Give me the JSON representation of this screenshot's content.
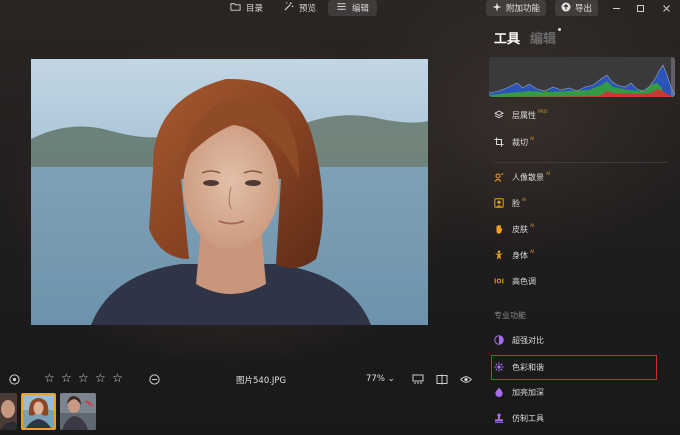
{
  "top_bar": {
    "tabs": [
      {
        "label": "目录",
        "icon": "folder-icon"
      },
      {
        "label": "预览",
        "icon": "magic-wand-icon"
      },
      {
        "label": "编辑",
        "icon": "sliders-icon"
      }
    ],
    "addon_label": "附加功能",
    "export_label": "导出"
  },
  "panel": {
    "tabs": [
      "工具",
      "编辑"
    ],
    "items": [
      {
        "label": "层属性",
        "sup": "PRO",
        "icon": "layers-icon"
      },
      {
        "label": "裁切",
        "sup": "AI",
        "icon": "crop-icon"
      },
      {
        "label": "人像散景",
        "sup": "AI",
        "icon": "portrait-bokeh-icon"
      },
      {
        "label": "脸",
        "sup": "AI",
        "icon": "face-icon"
      },
      {
        "label": "皮肤",
        "sup": "AI",
        "icon": "skin-icon"
      },
      {
        "label": "身体",
        "sup": "AI",
        "icon": "body-icon"
      },
      {
        "label": "高色调",
        "sup": "",
        "icon": "tone-icon"
      }
    ],
    "section_label": "专业功能",
    "pro_items": [
      {
        "label": "超强对比",
        "icon": "contrast-icon"
      },
      {
        "label": "色彩和谐",
        "icon": "color-harmony-icon"
      },
      {
        "label": "加亮加深",
        "icon": "dodge-burn-icon"
      },
      {
        "label": "仿制工具",
        "icon": "clone-stamp-icon"
      }
    ]
  },
  "bottom_bar": {
    "rating": 0,
    "filename": "图片540.JPG",
    "zoom": "77%"
  },
  "colors": {
    "accent_orange": "#f0a020",
    "highlight_red": "#d8262b",
    "pro_purple": "#a86cf0"
  }
}
